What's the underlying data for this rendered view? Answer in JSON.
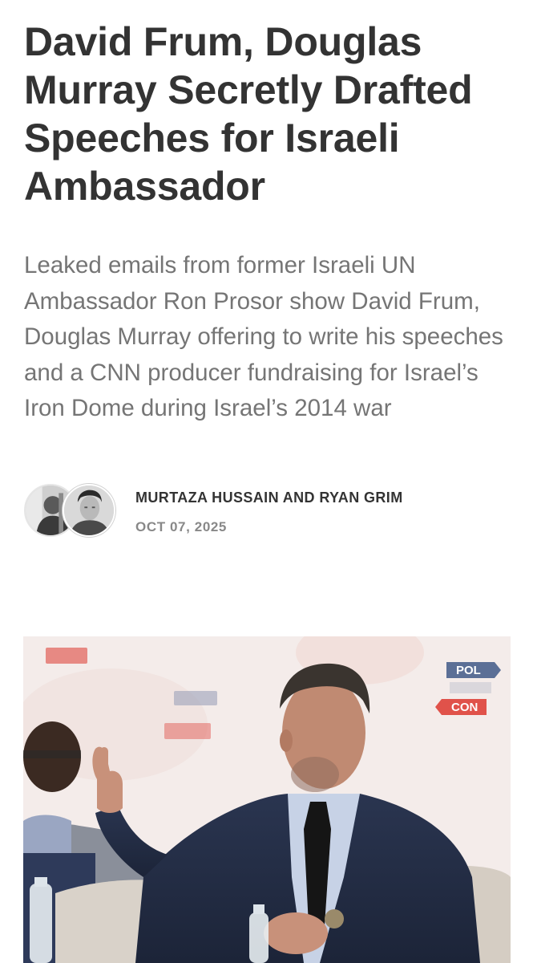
{
  "article": {
    "headline": "David Frum, Douglas Murray Secretly Drafted Speeches for Israeli Ambassador",
    "dek": "Leaked emails from former Israeli UN Ambassador Ron Prosor show David Frum, Douglas Murray offering to write his speeches and a CNN producer fundraising for Israel’s Iron Dome during Israel’s 2014 war",
    "byline": {
      "authors": "MURTAZA HUSSAIN AND RYAN GRIM",
      "date": "OCT 07, 2025",
      "avatars": [
        "author-avatar-1",
        "author-avatar-2"
      ]
    },
    "hero_image": {
      "description_icon": "photo",
      "sign_text_top": "POL",
      "sign_text_bottom": "CON"
    }
  },
  "colors": {
    "headline": "#333333",
    "dek": "#757575",
    "byline": "#333333",
    "date": "#888888",
    "sign_red": "#e0524a",
    "sign_blue": "#5b6f96"
  }
}
